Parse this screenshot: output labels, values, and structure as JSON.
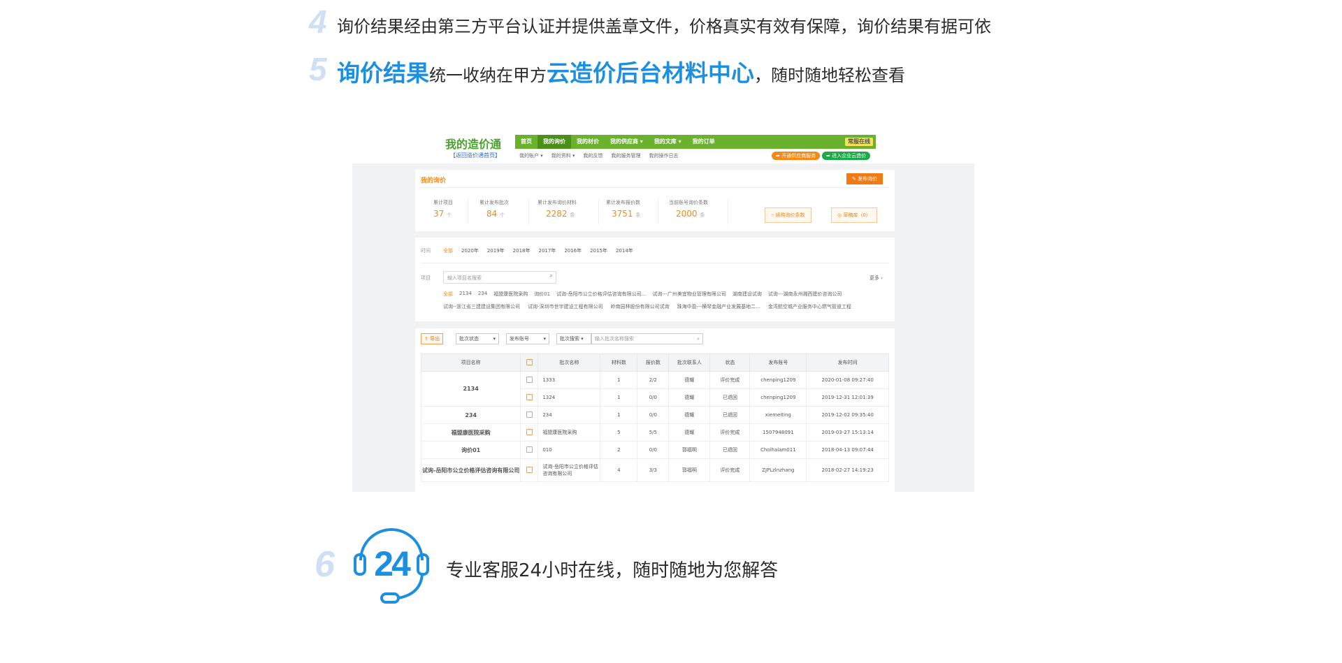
{
  "features": {
    "f4": {
      "num": "4",
      "text": "询价结果经由第三方平台认证并提供盖章文件，价格真实有效有保障，询价结果有据可依"
    },
    "f5": {
      "num": "5",
      "hl1": "询价结果",
      "mid": "统一收纳在甲方",
      "hl2": "云造价后台材料中心",
      "tail": "，随时随地轻松查看"
    },
    "f6": {
      "num": "6",
      "icon_label": "24",
      "text": "专业客服24小时在线，随时随地为您解答"
    }
  },
  "colors": {
    "accent": "#1d8fe0",
    "number": "#cfe0f4",
    "nav_green": "#6ab22d",
    "orange": "#f08a1c"
  },
  "screenshot": {
    "logo": {
      "title": "我的造价通",
      "sub": "【返回造价通首页】"
    },
    "nav": [
      "首页",
      "我的询价",
      "我的材价",
      "我的供应商 ▾",
      "我的文库 ▾",
      "我的订单"
    ],
    "nav_right": "常服在线",
    "subnav": [
      "我的账户 ▾",
      "我的资料 ▾",
      "我的反馈",
      "我的服务管理",
      "我的操作日志"
    ],
    "pill_orange": "开通供应商服务",
    "pill_green": "进入企业云造价",
    "card1": {
      "title": "我的询价",
      "publish_button": "发布询价",
      "stats": [
        {
          "label": "累计项目",
          "value": "37",
          "unit": "个"
        },
        {
          "label": "累计发布批次",
          "value": "84",
          "unit": "个"
        },
        {
          "label": "累计发布询价材料",
          "value": "2282",
          "unit": "条"
        },
        {
          "label": "累计发布报价数",
          "value": "3751",
          "unit": "条"
        },
        {
          "label": "当前账号询价条数",
          "value": "2000",
          "unit": "条"
        }
      ],
      "btn_record": "续购询价条数",
      "btn_lib": "草稿库（0）"
    },
    "card2": {
      "time_label": "时间",
      "years": [
        "全部",
        "2020年",
        "2019年",
        "2018年",
        "2017年",
        "2016年",
        "2015年",
        "2014年"
      ],
      "project_label": "项目",
      "search_placeholder": "输入项目名搜索",
      "more": "更多 ›",
      "tags_row1": [
        "全部",
        "2134",
        "234",
        "福盟康医院采购",
        "询价01",
        "试询-岳阳市公立价格评估咨询有限公司...",
        "试询---广州美宜物业管理有限公司",
        "湖南建设试询",
        "试询---湖南永州湘西建价咨询公司"
      ],
      "tags_row2": [
        "试询--浙江省三建建设集团有限公司",
        "试询-深圳市世宇建设工程有限公司",
        "岭南园林股份有限公司试询",
        "珠海中盈---横琴金融产业发展基地二...",
        "金湾航空城产业服务中心燃气管道工程"
      ]
    },
    "card3": {
      "export": "导出",
      "filter1": "批次状态",
      "filter2": "发布账号",
      "filter3": "批次搜索",
      "batch_placeholder": "输入批次名称搜索",
      "headers": [
        "项目名称",
        "",
        "批次名称",
        "材料数",
        "报价数",
        "批次联系人",
        "状态",
        "发布账号",
        "发布时间"
      ],
      "rows": [
        {
          "project": "2134",
          "batch": "1333",
          "materials": "1",
          "quotes": "2/2",
          "contact": "德耀",
          "status": "评价完成",
          "account": "chenping1209",
          "time": "2020-01-08 09:27:40"
        },
        {
          "project": "",
          "batch": "1324",
          "materials": "1",
          "quotes": "0/0",
          "contact": "德耀",
          "status": "已退回",
          "account": "chenping1209",
          "time": "2019-12-31 12:01:39"
        },
        {
          "project": "234",
          "batch": "234",
          "materials": "1",
          "quotes": "0/0",
          "contact": "德耀",
          "status": "已退回",
          "account": "xiemeiting",
          "time": "2019-12-02 09:35:40"
        },
        {
          "project": "福盟康医院采购",
          "batch": "福盟康医院采购",
          "materials": "5",
          "quotes": "5/5",
          "contact": "德耀",
          "status": "评价完成",
          "account": "1507948091",
          "time": "2019-03-27 15:13:14"
        },
        {
          "project": "询价01",
          "batch": "010",
          "materials": "2",
          "quotes": "0/0",
          "contact": "郭福明",
          "status": "已退回",
          "account": "Choihalam011",
          "time": "2018-04-13 09:07:44"
        },
        {
          "project": "试询-岳阳市公立价格评估咨询有限公司",
          "batch": "试询-岳阳市公立价格评估咨询有限公司",
          "materials": "4",
          "quotes": "3/3",
          "contact": "郭福明",
          "status": "评价完成",
          "account": "ZJPLzlnzhang",
          "time": "2018-02-27 14:19:23"
        }
      ]
    }
  }
}
